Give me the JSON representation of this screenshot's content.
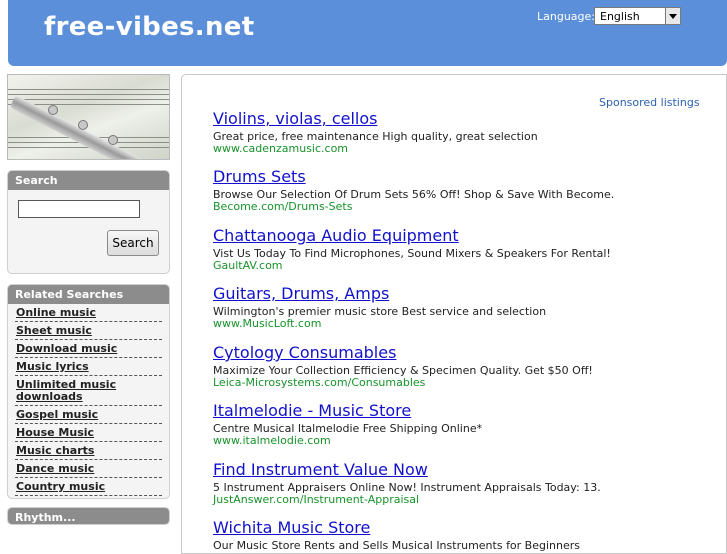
{
  "header": {
    "logo": "free-vibes.net",
    "language_label": "Language:",
    "language_value": "English"
  },
  "sidebar": {
    "search": {
      "title": "Search",
      "input_value": "",
      "button_label": "Search"
    },
    "related": {
      "title": "Related Searches",
      "items": [
        "Online music",
        "Sheet music",
        "Download music",
        "Music lyrics",
        "Unlimited music downloads",
        "Gospel music",
        "House Music",
        "Music charts",
        "Dance music",
        "Country music"
      ]
    },
    "next_box_title": "Rhythm..."
  },
  "main": {
    "sponsored_label": "Sponsored listings",
    "listings": [
      {
        "title": "Violins, violas, cellos",
        "desc": "Great price, free maintenance High quality, great selection",
        "url": "www.cadenzamusic.com"
      },
      {
        "title": "Drums Sets",
        "desc": "Browse Our Selection Of Drum Sets 56% Off! Shop & Save With Become.",
        "url": "Become.com/Drums-Sets"
      },
      {
        "title": "Chattanooga Audio Equipment",
        "desc": "Vist Us Today To Find Microphones, Sound Mixers & Speakers For Rental!",
        "url": "GaultAV.com"
      },
      {
        "title": "Guitars, Drums, Amps",
        "desc": "Wilmington's premier music store Best service and selection",
        "url": "www.MusicLoft.com"
      },
      {
        "title": "Cytology Consumables",
        "desc": "Maximize Your Collection Efficiency & Specimen Quality. Get $50 Off!",
        "url": "Leica-Microsystems.com/Consumables"
      },
      {
        "title": "Italmelodie - Music Store",
        "desc": "Centre Musical Italmelodie Free Shipping Online*",
        "url": "www.italmelodie.com"
      },
      {
        "title": "Find Instrument Value Now",
        "desc": "5 Instrument Appraisers Online Now! Instrument Appraisals Today: 13.",
        "url": "JustAnswer.com/Instrument-Appraisal"
      },
      {
        "title": "Wichita Music Store",
        "desc": "Our Music Store Rents and Sells Musical Instruments for Beginners",
        "url": ""
      }
    ]
  }
}
